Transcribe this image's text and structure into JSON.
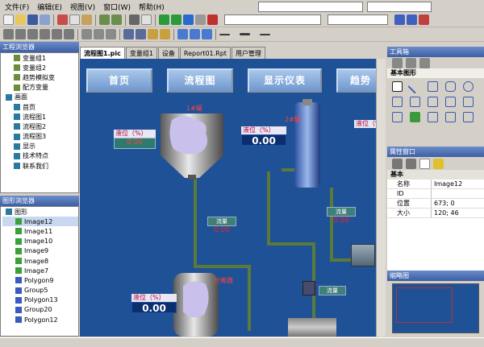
{
  "menu": [
    "文件(F)",
    "编辑(E)",
    "视图(V)",
    "窗口(W)",
    "帮助(H)"
  ],
  "tabs": [
    "流程图1.pic",
    "变量组1",
    "设备",
    "Report01.Rpt",
    "用户管理"
  ],
  "left_panel_top": {
    "title": "工程浏览器",
    "items": [
      "变量组1",
      "变量组2",
      "趋势模拟变",
      "配方变量",
      "画面",
      "首页",
      "流程图1",
      "流程图2",
      "流程图3",
      "显示",
      "技术特点",
      "联系我们"
    ]
  },
  "left_panel_bottom": {
    "title": "图形浏览器",
    "items": [
      "图形",
      "Image12",
      "Image11",
      "Image10",
      "Image9",
      "Image8",
      "Image7",
      "Polygon9",
      "Group5",
      "Polygon13",
      "Group20",
      "Polygon12"
    ]
  },
  "canvas": {
    "nav": [
      "首页",
      "流程图",
      "显示仪表",
      "趋势"
    ],
    "tanks": [
      "1#罐",
      "2#罐",
      "分离器"
    ],
    "level_label": "液位（%）",
    "level_value_1": "0.00",
    "level_value_2": "0.00",
    "level_value_3": "0.00",
    "tag1": "流量",
    "tag2": "流量",
    "tag3": "流量",
    "red_values": [
      "0.00",
      "0.00",
      "0.00"
    ],
    "level_label_right": "液位（%）"
  },
  "toolbox": {
    "title": "工具箱",
    "section": "基本图形"
  },
  "properties": {
    "title": "属性窗口",
    "section": "基本",
    "rows": [
      {
        "k": "名称",
        "v": "Image12"
      },
      {
        "k": "ID",
        "v": ""
      },
      {
        "k": "位置",
        "v": "673; 0"
      },
      {
        "k": "大小",
        "v": "120; 46"
      }
    ]
  },
  "preview": {
    "title": "缩略图"
  },
  "colors": {
    "canvas": "#1f5196",
    "pipe": "#5b7a3a",
    "header": "#3d5fa5"
  }
}
